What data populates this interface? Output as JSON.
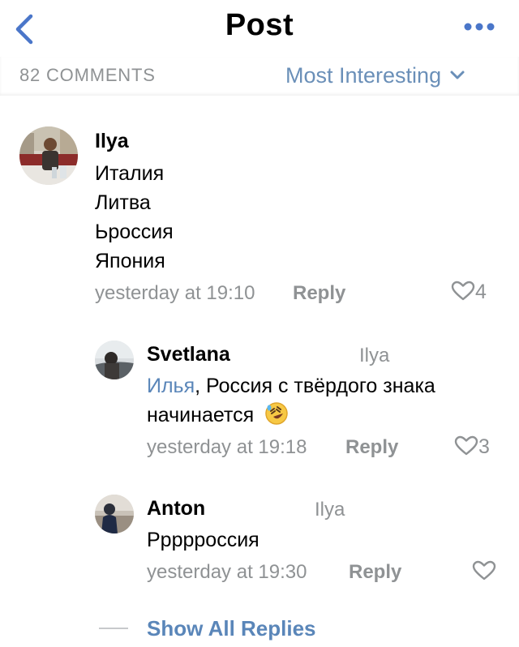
{
  "header": {
    "title": "Post",
    "back_icon": "chevron-left-icon",
    "more_icon": "more-horizontal-icon",
    "accent": "#4a76c9"
  },
  "comments_bar": {
    "count_label": "82 COMMENTS",
    "sort_label": "Most Interesting",
    "sort_icon": "chevron-down-icon"
  },
  "comments": [
    {
      "author": "Ilya",
      "lines": [
        "Италия",
        "Литва",
        "Ьроссия",
        "Япония"
      ],
      "time": "yesterday at 19:10",
      "reply_label": "Reply",
      "likes": "4"
    }
  ],
  "replies": [
    {
      "author": "Svetlana",
      "reply_to": "Ilya",
      "mention": "Илья",
      "text_line1": ", Россия с твёрдого знака",
      "text_line2": "начинается",
      "emoji": "🤣",
      "time": "yesterday at 19:18",
      "reply_label": "Reply",
      "likes": "3"
    },
    {
      "author": "Anton",
      "reply_to": "Ilya",
      "text_line1": "Ррррроссия",
      "time": "yesterday at 19:30",
      "reply_label": "Reply",
      "likes": ""
    }
  ],
  "footer": {
    "show_all_label": "Show All Replies"
  },
  "colors": {
    "link": "#5a86b9",
    "muted": "#8f9294",
    "text": "#000000"
  }
}
